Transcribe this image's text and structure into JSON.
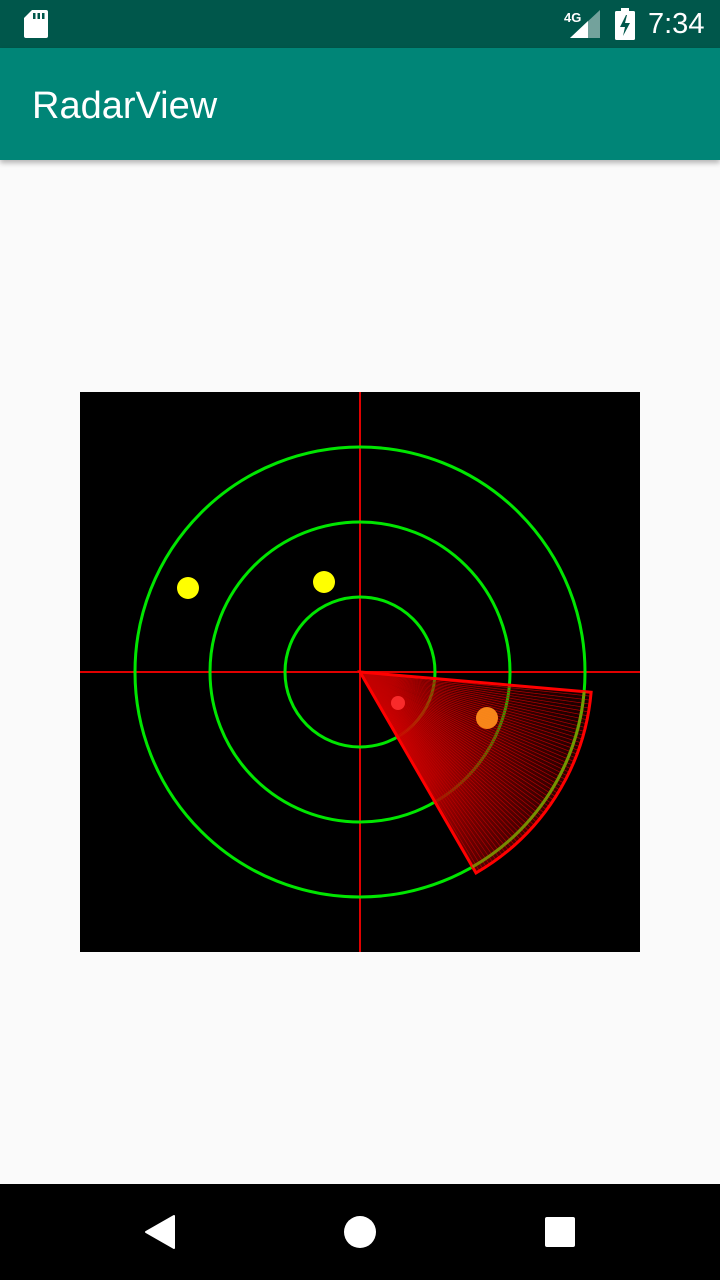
{
  "status_bar": {
    "time": "7:34",
    "network_label": "4G",
    "icons": [
      "sd-card-icon",
      "signal-4g-icon",
      "battery-charging-icon"
    ]
  },
  "app_bar": {
    "title": "RadarView"
  },
  "radar": {
    "colors": {
      "background": "#000000",
      "rings": "#00e600",
      "crosshair": "#e00000",
      "sweep": "#ff0000",
      "target_yellow": "#ffff00",
      "target_orange": "#ff8c1a"
    },
    "ring_count": 3,
    "sweep_angle_start_deg": 5,
    "sweep_angle_end_deg": 60
  },
  "nav_bar": {
    "buttons": [
      "back-icon",
      "home-icon",
      "recents-icon"
    ]
  }
}
